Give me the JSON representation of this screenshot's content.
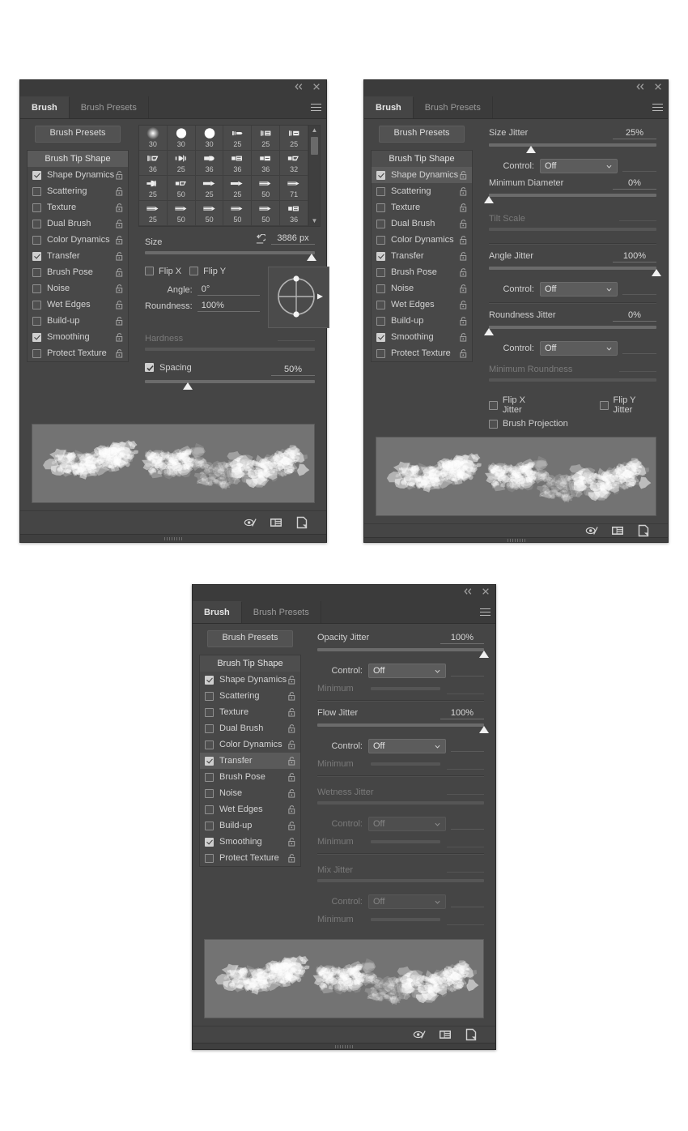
{
  "window": {
    "collapse_icon": "double-chevron-left-icon",
    "close_icon": "close-icon",
    "menu_icon": "panel-menu-icon"
  },
  "tabs": [
    {
      "label": "Brush",
      "active": true
    },
    {
      "label": "Brush Presets",
      "active": false
    }
  ],
  "presets_button": "Brush Presets",
  "options": {
    "header": "Brush Tip Shape",
    "items": [
      {
        "label": "Shape Dynamics",
        "checked": true,
        "lock": "unlocked"
      },
      {
        "label": "Scattering",
        "checked": false,
        "lock": "unlocked"
      },
      {
        "label": "Texture",
        "checked": false,
        "lock": "unlocked"
      },
      {
        "label": "Dual Brush",
        "checked": false,
        "lock": "unlocked"
      },
      {
        "label": "Color Dynamics",
        "checked": false,
        "lock": "unlocked"
      },
      {
        "label": "Transfer",
        "checked": true,
        "lock": "unlocked"
      },
      {
        "label": "Brush Pose",
        "checked": false,
        "lock": "unlocked"
      },
      {
        "label": "Noise",
        "checked": false,
        "lock": "unlocked"
      },
      {
        "label": "Wet Edges",
        "checked": false,
        "lock": "unlocked"
      },
      {
        "label": "Build-up",
        "checked": false,
        "lock": "unlocked"
      },
      {
        "label": "Smoothing",
        "checked": true,
        "lock": "unlocked"
      },
      {
        "label": "Protect Texture",
        "checked": false,
        "lock": "unlocked"
      }
    ]
  },
  "panel1": {
    "selected_option": "Brush Tip Shape",
    "brush_grid": {
      "rows": [
        [
          {
            "size": "30",
            "tip": "soft-round"
          },
          {
            "size": "30",
            "tip": "hard-round"
          },
          {
            "size": "30",
            "tip": "hard-round-solid"
          },
          {
            "size": "25",
            "tip": "flat-tip-a"
          },
          {
            "size": "25",
            "tip": "flat-tip-b"
          },
          {
            "size": "25",
            "tip": "flat-tip-c"
          }
        ],
        [
          {
            "size": "36",
            "tip": "angled-flat"
          },
          {
            "size": "25",
            "tip": "fan-tip"
          },
          {
            "size": "36",
            "tip": "round-point"
          },
          {
            "size": "36",
            "tip": "square-flat"
          },
          {
            "size": "36",
            "tip": "blunt-flat"
          },
          {
            "size": "32",
            "tip": "angled-wedge"
          }
        ],
        [
          {
            "size": "25",
            "tip": "cone-tip"
          },
          {
            "size": "50",
            "tip": "wedge-flat"
          },
          {
            "size": "25",
            "tip": "arrow-tip-a"
          },
          {
            "size": "25",
            "tip": "arrow-tip-b"
          },
          {
            "size": "50",
            "tip": "pencil-tip-a"
          },
          {
            "size": "71",
            "tip": "pencil-tip-b"
          }
        ],
        [
          {
            "size": "25",
            "tip": "pencil-tip-c"
          },
          {
            "size": "50",
            "tip": "pencil-tip-d"
          },
          {
            "size": "50",
            "tip": "pencil-tip-e"
          },
          {
            "size": "50",
            "tip": "pencil-tip-f"
          },
          {
            "size": "50",
            "tip": "pencil-tip-g"
          },
          {
            "size": "36",
            "tip": "block-flat"
          }
        ]
      ]
    },
    "size": {
      "label": "Size",
      "value": "3886 px",
      "reset_icon": "reset-arrow-icon",
      "slider_pct": 98
    },
    "flip_x": {
      "label": "Flip X",
      "checked": false
    },
    "flip_y": {
      "label": "Flip Y",
      "checked": false
    },
    "angle": {
      "label": "Angle:",
      "value": "0°"
    },
    "roundness": {
      "label": "Roundness:",
      "value": "100%"
    },
    "hardness": {
      "label": "Hardness",
      "value": "",
      "enabled": false,
      "slider_pct": 0
    },
    "spacing": {
      "label": "Spacing",
      "checked": true,
      "value": "50%",
      "slider_pct": 25
    }
  },
  "panel2": {
    "selected_option": "Shape Dynamics",
    "size_jitter": {
      "label": "Size Jitter",
      "value": "25%",
      "slider_pct": 25
    },
    "size_control": {
      "label": "Control:",
      "value": "Off",
      "enabled": true
    },
    "minimum_diameter": {
      "label": "Minimum Diameter",
      "value": "0%",
      "slider_pct": 0
    },
    "tilt_scale": {
      "label": "Tilt Scale",
      "value": "",
      "enabled": false,
      "slider_pct": 0
    },
    "angle_jitter": {
      "label": "Angle Jitter",
      "value": "100%",
      "slider_pct": 100
    },
    "angle_control": {
      "label": "Control:",
      "value": "Off",
      "enabled": true
    },
    "roundness_jitter": {
      "label": "Roundness Jitter",
      "value": "0%",
      "slider_pct": 0
    },
    "roundness_control": {
      "label": "Control:",
      "value": "Off",
      "enabled": true
    },
    "minimum_roundness": {
      "label": "Minimum Roundness",
      "value": "",
      "enabled": false,
      "slider_pct": 0
    },
    "flip_x_jitter": {
      "label": "Flip X Jitter",
      "checked": false
    },
    "flip_y_jitter": {
      "label": "Flip Y Jitter",
      "checked": false
    },
    "brush_projection": {
      "label": "Brush Projection",
      "checked": false
    }
  },
  "panel3": {
    "selected_option": "Transfer",
    "opacity_jitter": {
      "label": "Opacity Jitter",
      "value": "100%",
      "slider_pct": 100
    },
    "opacity_control": {
      "label": "Control:",
      "value": "Off",
      "enabled": true
    },
    "opacity_minimum": {
      "label": "Minimum",
      "value": "",
      "enabled": false
    },
    "flow_jitter": {
      "label": "Flow Jitter",
      "value": "100%",
      "slider_pct": 100
    },
    "flow_control": {
      "label": "Control:",
      "value": "Off",
      "enabled": true
    },
    "flow_minimum": {
      "label": "Minimum",
      "value": "",
      "enabled": false
    },
    "wetness_jitter": {
      "label": "Wetness Jitter",
      "value": "",
      "enabled": false,
      "slider_pct": 0
    },
    "wetness_control": {
      "label": "Control:",
      "value": "Off",
      "enabled": false
    },
    "wetness_minimum": {
      "label": "Minimum",
      "value": "",
      "enabled": false
    },
    "mix_jitter": {
      "label": "Mix Jitter",
      "value": "",
      "enabled": false,
      "slider_pct": 0
    },
    "mix_control": {
      "label": "Control:",
      "value": "Off",
      "enabled": false
    },
    "mix_minimum": {
      "label": "Minimum",
      "value": "",
      "enabled": false
    }
  },
  "footer_icons": [
    {
      "name": "toggle-brush-dynamics-icon"
    },
    {
      "name": "create-new-brush-preset-icon"
    },
    {
      "name": "new-brush-icon"
    }
  ],
  "colors": {
    "panel_bg": "#454545",
    "titlebar_bg": "#3b3b3b",
    "selected_row": "#5a5a5a",
    "preview_bg": "#737373",
    "text": "#cfcfcf",
    "text_dim": "#7a7a7a"
  }
}
